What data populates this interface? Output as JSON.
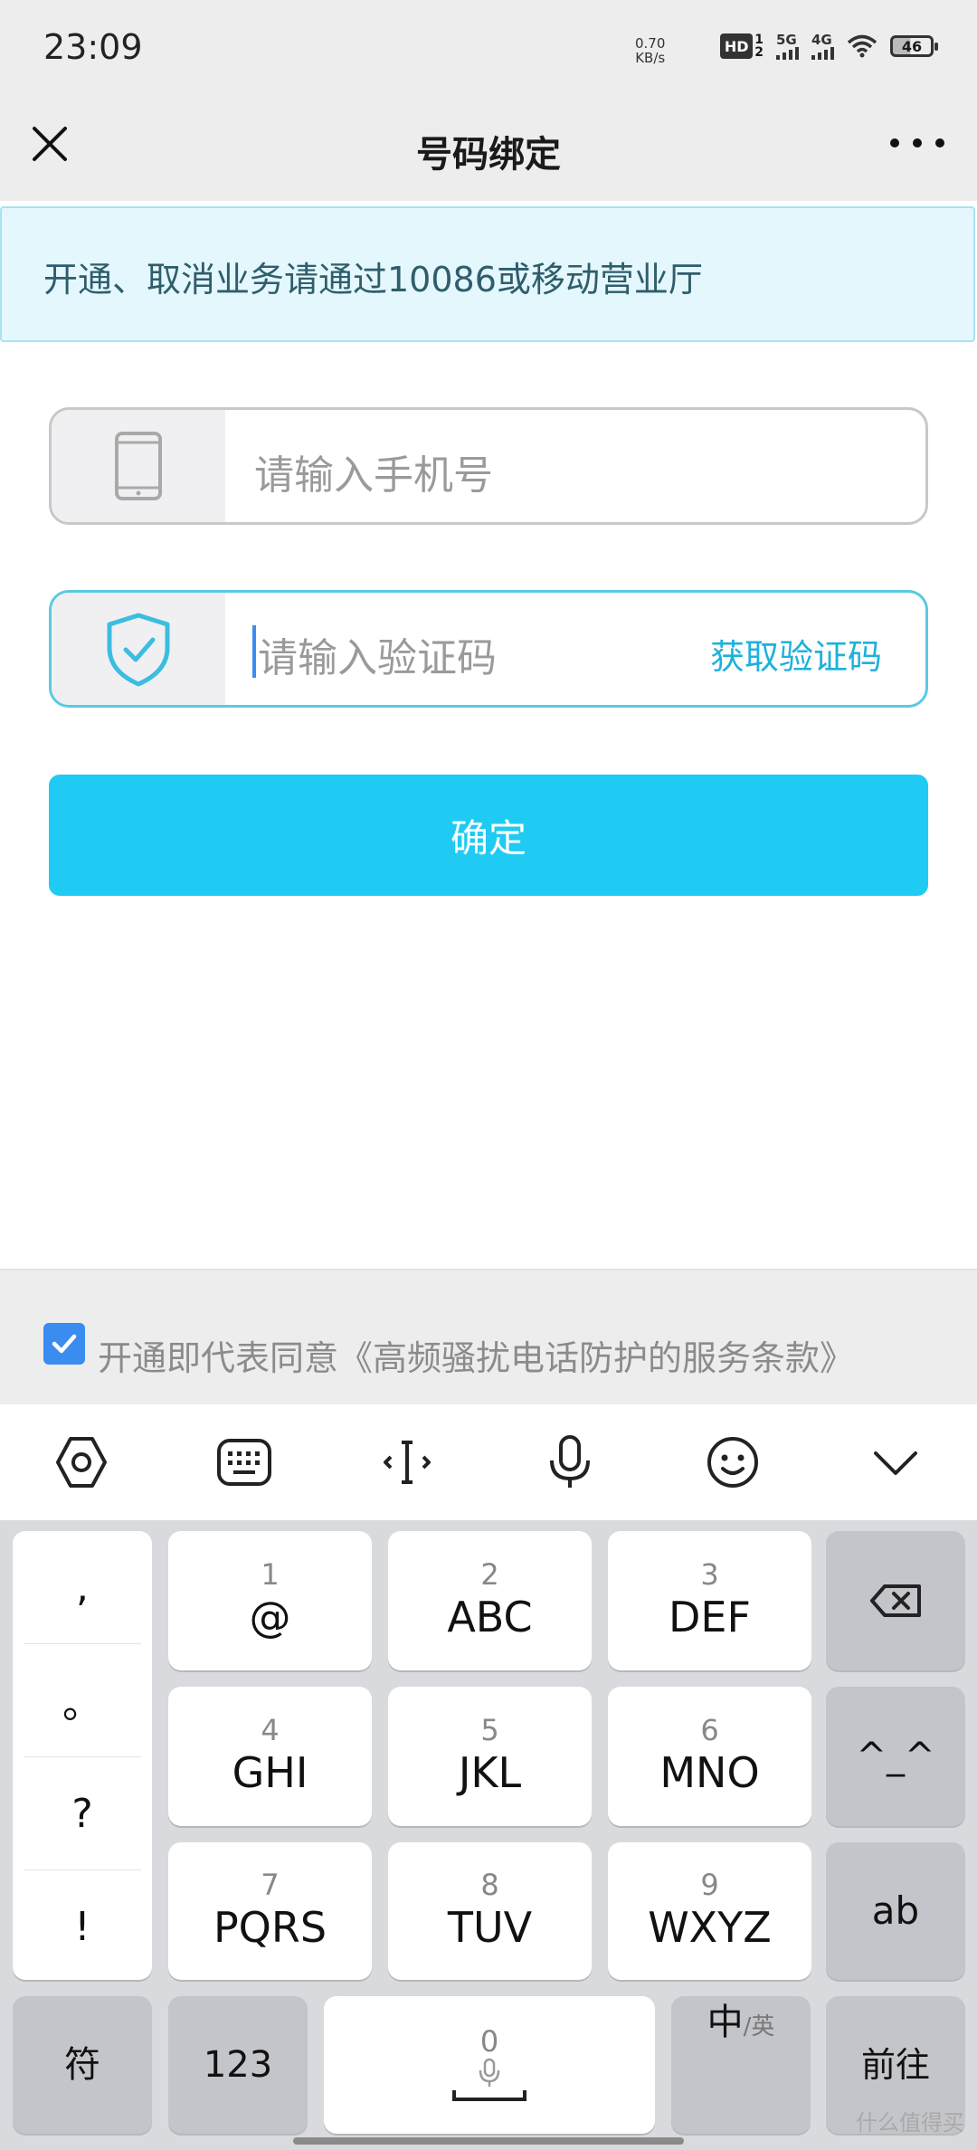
{
  "status_bar": {
    "time": "23:09",
    "rate": "0.70",
    "rate_unit": "KB/s",
    "hd": "HD",
    "sim1": "1",
    "sim2": "2",
    "net1": "5G",
    "net2": "4G",
    "battery": "46"
  },
  "nav": {
    "title": "号码绑定"
  },
  "notice": "开通、取消业务请通过10086或移动营业厅",
  "phone_field": {
    "placeholder": "请输入手机号"
  },
  "code_field": {
    "placeholder": "请输入验证码",
    "get_code_label": "获取验证码"
  },
  "confirm_label": "确定",
  "agreement": {
    "checked": true,
    "text": "开通即代表同意《高频骚扰电话防护的服务条款》"
  },
  "keyboard": {
    "punctuation": [
      ",",
      "。",
      "?",
      "!"
    ],
    "keys": [
      {
        "num": "1",
        "letters": "@"
      },
      {
        "num": "2",
        "letters": "ABC"
      },
      {
        "num": "3",
        "letters": "DEF"
      },
      {
        "num": "4",
        "letters": "GHI"
      },
      {
        "num": "5",
        "letters": "JKL"
      },
      {
        "num": "6",
        "letters": "MNO"
      },
      {
        "num": "7",
        "letters": "PQRS"
      },
      {
        "num": "8",
        "letters": "TUV"
      },
      {
        "num": "9",
        "letters": "WXYZ"
      }
    ],
    "emoticon": "^_^",
    "ab": "ab",
    "symbols": "符",
    "numbers": "123",
    "space_num": "0",
    "lang_main": "中",
    "lang_alt": "/英",
    "enter": "前往"
  },
  "watermark": "什么值得买"
}
